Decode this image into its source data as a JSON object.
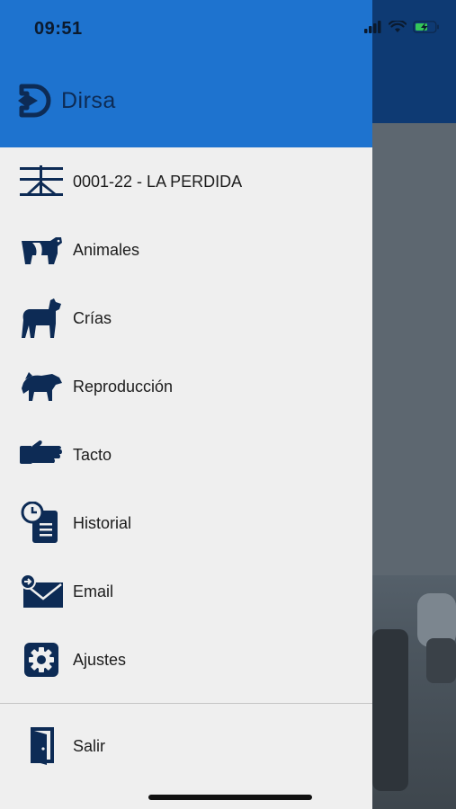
{
  "status_bar": {
    "time": "09:51"
  },
  "brand": {
    "name": "Dirsa"
  },
  "menu": {
    "items": [
      {
        "label": "0001-22 - LA PERDIDA",
        "icon": "ranch-gate-icon"
      },
      {
        "label": "Animales",
        "icon": "cow-icon"
      },
      {
        "label": "Crías",
        "icon": "calf-icon"
      },
      {
        "label": "Reproducción",
        "icon": "breeding-icon"
      },
      {
        "label": "Tacto",
        "icon": "glove-icon"
      },
      {
        "label": "Historial",
        "icon": "history-icon"
      },
      {
        "label": "Email",
        "icon": "email-icon"
      },
      {
        "label": "Ajustes",
        "icon": "settings-icon"
      }
    ],
    "logout": {
      "label": "Salir",
      "icon": "exit-door-icon"
    }
  },
  "colors": {
    "header": "#1e73cf",
    "icon": "#0d2b55",
    "drawer_bg": "#efefef",
    "app_header": "#0e3a73"
  }
}
